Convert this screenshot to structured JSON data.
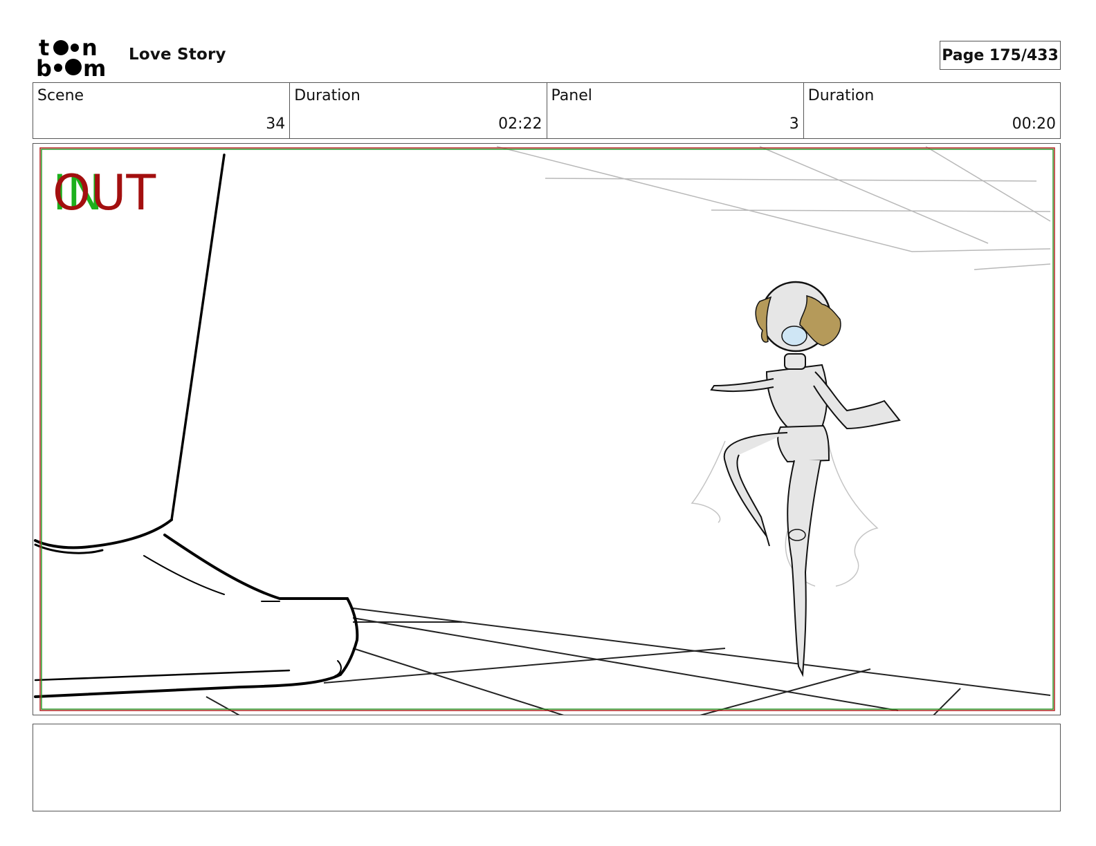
{
  "header": {
    "logo_text": "toon boom",
    "project_title": "Love Story",
    "page_label": "Page 175/433"
  },
  "info": [
    {
      "label": "Scene",
      "value": "34"
    },
    {
      "label": "Duration",
      "value": "02:22"
    },
    {
      "label": "Panel",
      "value": "3"
    },
    {
      "label": "Duration",
      "value": "00:20"
    }
  ],
  "panel": {
    "in_marker": "IN",
    "out_marker": "OUT",
    "in_color": "#1db01d",
    "out_color": "#a30f0f",
    "safe_frame_red": "#b32020",
    "safe_frame_green": "#2a9a2a",
    "hair_color": "#b59a5a",
    "visor_color": "#cfe6f5",
    "body_fill": "#e6e6e6"
  },
  "notes": {
    "text": ""
  }
}
